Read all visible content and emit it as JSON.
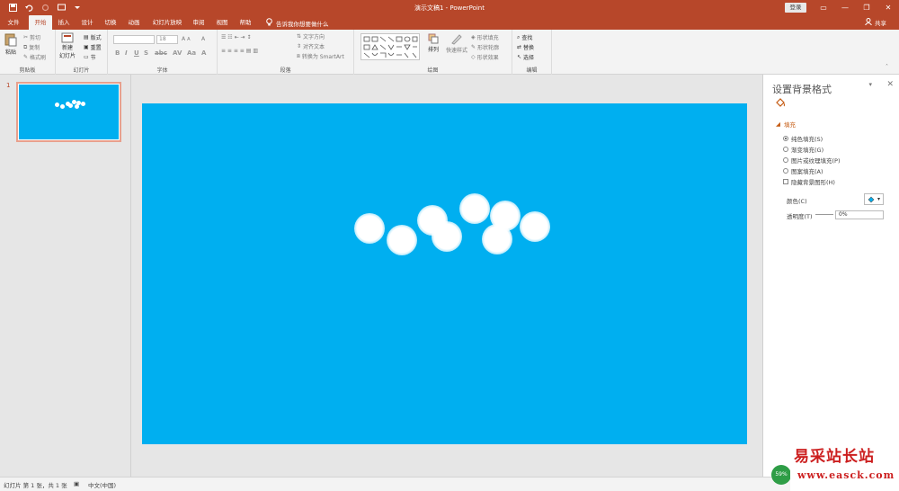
{
  "titlebar": {
    "doc_title": "演示文稿1  -  PowerPoint",
    "login_label": "登录",
    "bg_color": "#b7472a"
  },
  "tabs": [
    {
      "label": "文件"
    },
    {
      "label": "开始"
    },
    {
      "label": "插入"
    },
    {
      "label": "设计"
    },
    {
      "label": "切换"
    },
    {
      "label": "动画"
    },
    {
      "label": "幻灯片放映"
    },
    {
      "label": "审阅"
    },
    {
      "label": "视图"
    },
    {
      "label": "帮助"
    }
  ],
  "tell_me": "告诉我你想要做什么",
  "share_label": "共享",
  "ribbon": {
    "clipboard": {
      "paste": "粘贴",
      "cut": "剪切",
      "copy": "复制",
      "format_painter": "格式刷",
      "label": "剪贴板"
    },
    "slides": {
      "new_slide": "新建",
      "new_slide2": "幻灯片",
      "layout": "版式",
      "reset": "重置",
      "section": "节",
      "label": "幻灯片"
    },
    "font": {
      "size": "18",
      "label": "字体"
    },
    "paragraph": {
      "text_direction": "文字方向",
      "align_text": "对齐文本",
      "smartart": "转换为 SmartArt",
      "label": "段落"
    },
    "drawing": {
      "arrange": "排列",
      "quick_styles": "快速样式",
      "shape_fill": "形状填充",
      "shape_outline": "形状轮廓",
      "shape_effects": "形状效果",
      "label": "绘图"
    },
    "editing": {
      "find": "查找",
      "replace": "替换",
      "select": "选择",
      "label": "编辑"
    }
  },
  "thumbnail": {
    "number": "1"
  },
  "slide": {
    "bg_color": "#00aff0"
  },
  "format_pane": {
    "title": "设置背景格式",
    "section": "填充",
    "options": [
      {
        "label": "纯色填充(S)",
        "selected": true
      },
      {
        "label": "渐变填充(G)",
        "selected": false
      },
      {
        "label": "图片或纹理填充(P)",
        "selected": false
      },
      {
        "label": "图案填充(A)",
        "selected": false
      }
    ],
    "hide_bg": "隐藏背景图形(H)",
    "color_label": "颜色(C)",
    "transparency_label": "透明度(T)",
    "transparency_value": "0%"
  },
  "status": {
    "slide_info": "幻灯片 第 1 张，共 1 张",
    "language": "中文(中国)"
  },
  "watermark": {
    "logo": "易采站长站",
    "url": "www.easck.com",
    "badge": "59%"
  }
}
